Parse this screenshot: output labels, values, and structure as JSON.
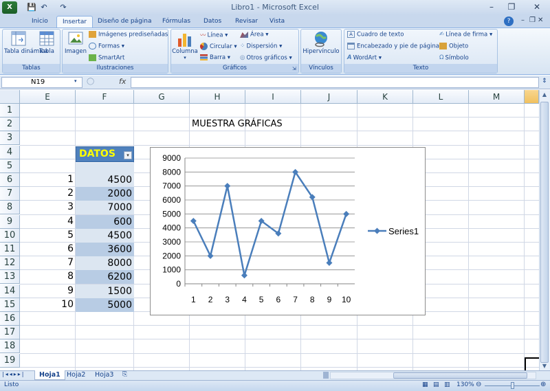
{
  "window": {
    "title": "Libro1 - Microsoft Excel"
  },
  "qat": {
    "save": "💾",
    "undo": "↶",
    "redo": "↷"
  },
  "tabs": [
    "Inicio",
    "Insertar",
    "Diseño de página",
    "Fórmulas",
    "Datos",
    "Revisar",
    "Vista"
  ],
  "ribbon": {
    "tablas": {
      "label": "Tablas",
      "tabla_dinamica": "Tabla dinámica",
      "tabla": "Tabla"
    },
    "ilustraciones": {
      "label": "Ilustraciones",
      "imagen": "Imagen",
      "imagenes_prediseñadas": "Imágenes prediseñadas",
      "formas": "Formas",
      "smartart": "SmartArt"
    },
    "graficos": {
      "label": "Gráficos",
      "columna": "Columna",
      "linea": "Línea",
      "circular": "Circular",
      "barra": "Barra",
      "area": "Área",
      "dispersion": "Dispersión",
      "otros": "Otros gráficos"
    },
    "vinculos": {
      "label": "Vínculos",
      "hipervinculo": "Hipervínculo"
    },
    "texto": {
      "label": "Texto",
      "cuadro": "Cuadro de texto",
      "encabezado": "Encabezado y pie de página",
      "wordart": "WordArt",
      "linea_firma": "Línea de firma",
      "objeto": "Objeto",
      "simbolo": "Símbolo"
    }
  },
  "formula": {
    "name_box": "N19",
    "fx": "fx",
    "value": ""
  },
  "columns": [
    "E",
    "F",
    "G",
    "H",
    "I",
    "J",
    "K",
    "L",
    "M"
  ],
  "rows": [
    "1",
    "2",
    "3",
    "4",
    "5",
    "6",
    "7",
    "8",
    "9",
    "10",
    "11",
    "12",
    "13",
    "14",
    "15",
    "16",
    "17",
    "18",
    "19"
  ],
  "sheet": {
    "title_text": "MUESTRA GRÁFICAS",
    "datos_header": "DATOS",
    "indices": [
      "1",
      "2",
      "3",
      "4",
      "5",
      "6",
      "7",
      "8",
      "9",
      "10"
    ],
    "values": [
      "4500",
      "2000",
      "7000",
      "600",
      "4500",
      "3600",
      "8000",
      "6200",
      "1500",
      "5000"
    ]
  },
  "chart_data": {
    "type": "line",
    "title": "",
    "categories": [
      "1",
      "2",
      "3",
      "4",
      "5",
      "6",
      "7",
      "8",
      "9",
      "10"
    ],
    "series": [
      {
        "name": "Series1",
        "values": [
          4500,
          2000,
          7000,
          600,
          4500,
          3600,
          8000,
          6200,
          1500,
          5000
        ]
      }
    ],
    "yticks": [
      "0",
      "1000",
      "2000",
      "3000",
      "4000",
      "5000",
      "6000",
      "7000",
      "8000",
      "9000"
    ],
    "ylim": [
      0,
      9000
    ],
    "grid": true,
    "legend": "right",
    "color": "#4a7ebb"
  },
  "sheettabs": [
    "Hoja1",
    "Hoja2",
    "Hoja3"
  ],
  "status": {
    "ready": "Listo",
    "zoom": "130%"
  }
}
